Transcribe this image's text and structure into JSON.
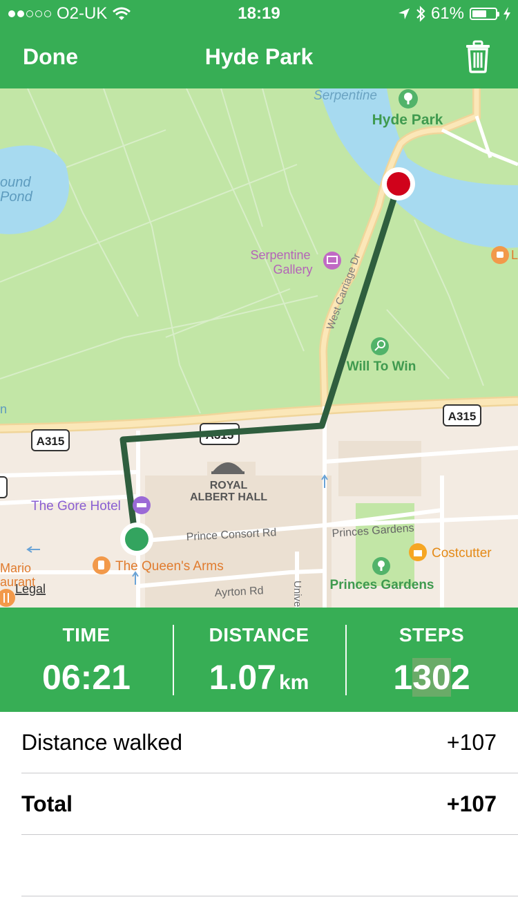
{
  "status_bar": {
    "carrier": "O2-UK",
    "time": "18:19",
    "battery": "61%",
    "battery_level": 0.61
  },
  "nav": {
    "done_label": "Done",
    "title": "Hyde Park",
    "trash_icon": "trash-icon"
  },
  "map": {
    "labels": {
      "serpentine": "Serpentine",
      "hyde_park": "Hyde Park",
      "round_pond_1": "ound",
      "round_pond_2": "Pond",
      "serpentine_gallery_1": "Serpentine",
      "serpentine_gallery_2": "Gallery",
      "west_carriage_dr": "West Carriage Dr",
      "will_to_win": "Will To Win",
      "a315_left": "A315",
      "a315_mid": "A315",
      "a315_right": "A315",
      "royal_albert_hall_1": "ROYAL",
      "royal_albert_hall_2": "ALBERT HALL",
      "gore_hotel": "The Gore Hotel",
      "prince_consort_rd": "Prince Consort Rd",
      "princes_gardens_road": "Princes Gardens",
      "costcutter": "Costcutter",
      "princes_gardens_park": "Princes Gardens",
      "queens_arms": "The Queen's Arms",
      "ayrton_rd": "Ayrton Rd",
      "univ": "Unive",
      "mario_1": "Mario",
      "mario_2": "aurant",
      "legal": "Legal",
      "edge_l": "L",
      "edge_n": "n"
    },
    "colors": {
      "park": "#c2e6a6",
      "water": "#a7daf0",
      "urban": "#f3ebe2",
      "route": "#2f5e3e",
      "start": "#33a45f",
      "end": "#d0021b"
    }
  },
  "stats": {
    "time_label": "TIME",
    "time_value": "06:21",
    "distance_label": "DISTANCE",
    "distance_value": "1.07",
    "distance_unit": "km",
    "steps_label": "STEPS",
    "steps_value_a": "1",
    "steps_value_b": "30",
    "steps_value_c": "2"
  },
  "rows": [
    {
      "label": "Distance walked",
      "value": "+107"
    },
    {
      "label": "Total",
      "value": "+107"
    }
  ]
}
